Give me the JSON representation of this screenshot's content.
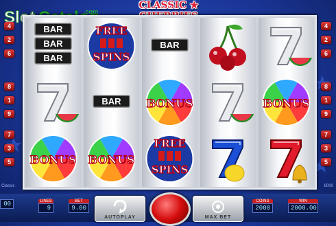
{
  "watermark": {
    "brand_part1": "Slot",
    "brand_part2": "Catalog",
    "tld": ".com"
  },
  "game_title": "CLASSIC ★ CHERRIES",
  "paylines": {
    "left": [
      "4",
      "2",
      "6",
      "8",
      "1",
      "9",
      "7",
      "3",
      "5"
    ],
    "right": [
      "4",
      "2",
      "6",
      "8",
      "1",
      "9",
      "7",
      "3",
      "5"
    ]
  },
  "reels": [
    [
      "triple-bar",
      "seven-watermelon",
      "bonus"
    ],
    [
      "free-spins",
      "bar",
      "bonus"
    ],
    [
      "bar",
      "bonus",
      "free-spins"
    ],
    [
      "cherries",
      "seven-watermelon",
      "blue-seven-lemon"
    ],
    [
      "seven-watermelon",
      "bonus",
      "red-seven-bell"
    ]
  ],
  "symbol_text": {
    "bar": "BAR",
    "bonus": "BONUS",
    "free": "FREE",
    "spins": "SPINS"
  },
  "side_left_text": "Classic",
  "side_right_text": "6000",
  "bottom": {
    "lines_label": "LINES",
    "lines_value": "9",
    "bet_label": "BET",
    "bet_value": "9.00",
    "autoplay_label": "AUTOPLAY",
    "maxbet_label": "MAX BET",
    "coins_label": "COINS",
    "coins_value": "2000",
    "win_label": "WIN",
    "win_value": "2000.00",
    "left_value": "00"
  },
  "colors": {
    "accent_red": "#d40d0d",
    "bg_blue": "#1a3596"
  }
}
